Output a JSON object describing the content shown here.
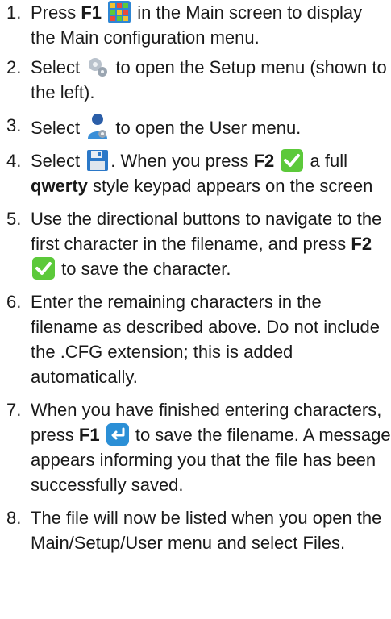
{
  "steps": [
    {
      "number": "1.",
      "parts": [
        "Press ",
        "F1",
        " in the Main screen to display the Main configuration menu."
      ],
      "icon": "main-menu-grid-icon"
    },
    {
      "number": "2.",
      "parts": [
        "Select ",
        " to open the Setup menu (shown to the left)."
      ],
      "icon": "setup-gears-icon"
    },
    {
      "number": "3.",
      "parts": [
        "Select ",
        " to open the User menu."
      ],
      "icon": "user-icon"
    },
    {
      "number": "4.",
      "parts": [
        "Select ",
        ". When you press ",
        "F2",
        " a full ",
        "qwerty",
        " style keypad appears on the screen"
      ],
      "icons": [
        "save-disk-icon",
        "green-checkmark-icon"
      ]
    },
    {
      "number": "5.",
      "parts": [
        "Use the directional buttons to navigate to the first character in the filename, and press ",
        "F2",
        " to save the character."
      ],
      "icon": "green-checkmark-icon"
    },
    {
      "number": "6.",
      "text": "Enter the remaining characters in the filename as described above. Do not include the .CFG extension; this is added automatically."
    },
    {
      "number": "7.",
      "parts": [
        "When you have finished entering characters, press ",
        "F1",
        " to save the filename. A message appears informing you that the file has been successfully saved."
      ],
      "icon": "enter-return-icon"
    },
    {
      "number": "8.",
      "text": "The file will now be listed when you open the Main/Setup/User menu and select Files."
    }
  ],
  "colors": {
    "text": "#1a1a1a",
    "check_green": "#5cc93a",
    "enter_blue": "#2b8fd6"
  }
}
